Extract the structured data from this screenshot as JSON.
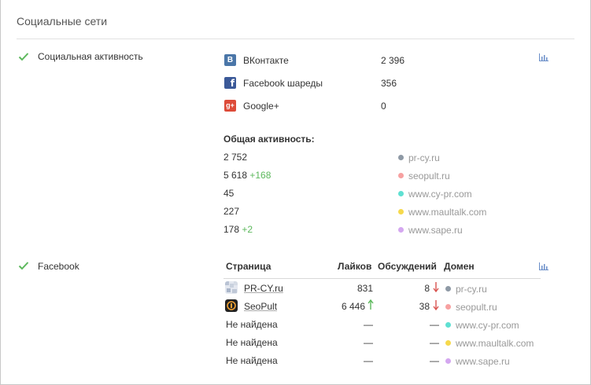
{
  "section": {
    "title": "Социальные сети"
  },
  "social_activity": {
    "label": "Социальная активность",
    "networks": [
      {
        "name": "ВКонтакте",
        "value": "2 396",
        "icon": "vk-icon",
        "color": "#4a76a8"
      },
      {
        "name": "Facebook шареды",
        "value": "356",
        "icon": "facebook-icon",
        "color": "#3b5998"
      },
      {
        "name": "Google+",
        "value": "0",
        "icon": "google-plus-icon",
        "color": "#dd4b39"
      }
    ],
    "total_label": "Общая активность:",
    "totals": [
      {
        "value": "2 752",
        "delta": "",
        "domain": "pr-cy.ru",
        "dot_color": "#8e99a5"
      },
      {
        "value": "5 618",
        "delta": "+168",
        "domain": "seopult.ru",
        "dot_color": "#f7a1a1"
      },
      {
        "value": "45",
        "delta": "",
        "domain": "www.cy-pr.com",
        "dot_color": "#5fe0d2"
      },
      {
        "value": "227",
        "delta": "",
        "domain": "www.maultalk.com",
        "dot_color": "#f6d94c"
      },
      {
        "value": "178",
        "delta": "+2",
        "domain": "www.sape.ru",
        "dot_color": "#d4a7f0"
      }
    ]
  },
  "facebook": {
    "label": "Facebook",
    "headers": {
      "page": "Страница",
      "likes": "Лайков",
      "discussions": "Обсуждений",
      "domain": "Домен"
    },
    "rows": [
      {
        "page": "PR-CY.ru",
        "likes": "831",
        "likes_trend": "",
        "discussions": "8",
        "discussions_trend": "down",
        "domain": "pr-cy.ru",
        "dot_color": "#8e99a5",
        "avatar": "pr-cy-avatar"
      },
      {
        "page": "SeoPult",
        "likes": "6 446",
        "likes_trend": "up",
        "discussions": "38",
        "discussions_trend": "down",
        "domain": "seopult.ru",
        "dot_color": "#f7a1a1",
        "avatar": "seopult-avatar"
      },
      {
        "page": "Не найдена",
        "likes": "—",
        "likes_trend": "",
        "discussions": "—",
        "discussions_trend": "",
        "domain": "www.cy-pr.com",
        "dot_color": "#5fe0d2",
        "avatar": ""
      },
      {
        "page": "Не найдена",
        "likes": "—",
        "likes_trend": "",
        "discussions": "—",
        "discussions_trend": "",
        "domain": "www.maultalk.com",
        "dot_color": "#f6d94c",
        "avatar": ""
      },
      {
        "page": "Не найдена",
        "likes": "—",
        "likes_trend": "",
        "discussions": "—",
        "discussions_trend": "",
        "domain": "www.sape.ru",
        "dot_color": "#d4a7f0",
        "avatar": ""
      }
    ]
  },
  "colors": {
    "check": "#5cb85c",
    "chart_icon": "#6b8fc9",
    "up_arrow": "#5cb85c",
    "down_arrow": "#d9534f"
  }
}
